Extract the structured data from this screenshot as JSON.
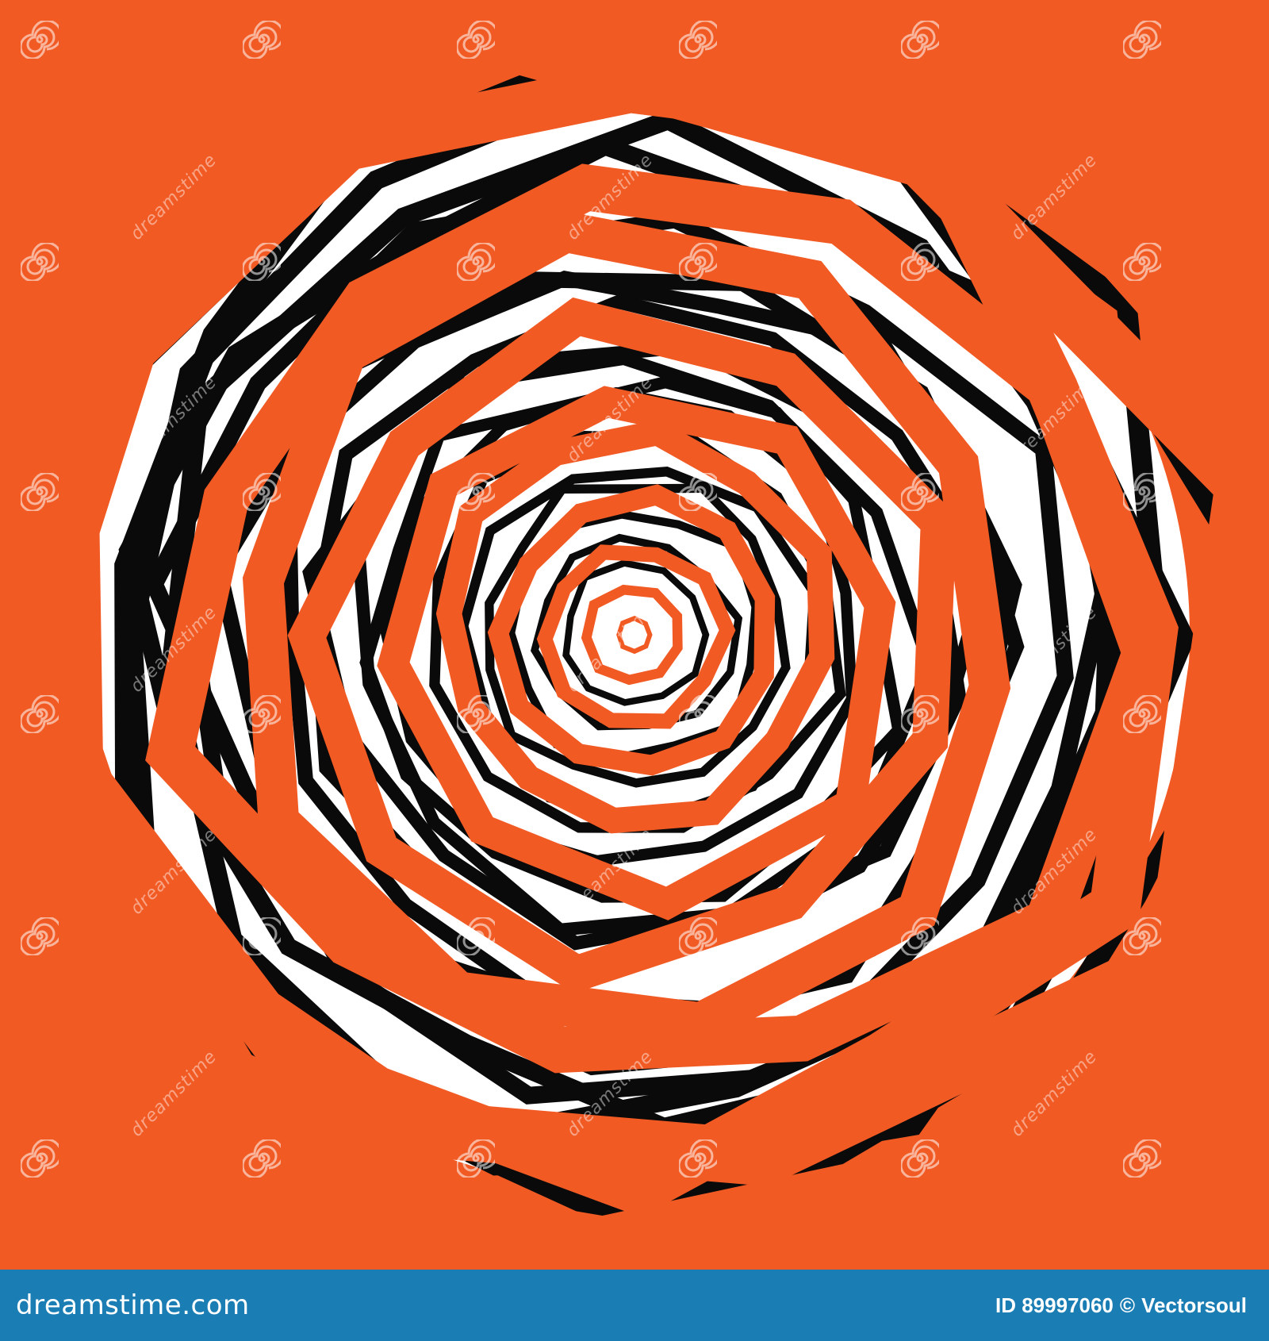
{
  "image": {
    "subject": "abstract concentric jagged polygon spiral",
    "colors": {
      "orange": "#f25a24",
      "black": "#0a0a0a",
      "white": "#ffffff",
      "footer": "#1a7db3"
    }
  },
  "watermark": {
    "text": "dreamstime",
    "icon": "spiral-icon"
  },
  "footer": {
    "logo": "dreamstime.com",
    "id_label": "ID 89997060",
    "separator": "©",
    "author": "Vectorsoul"
  }
}
